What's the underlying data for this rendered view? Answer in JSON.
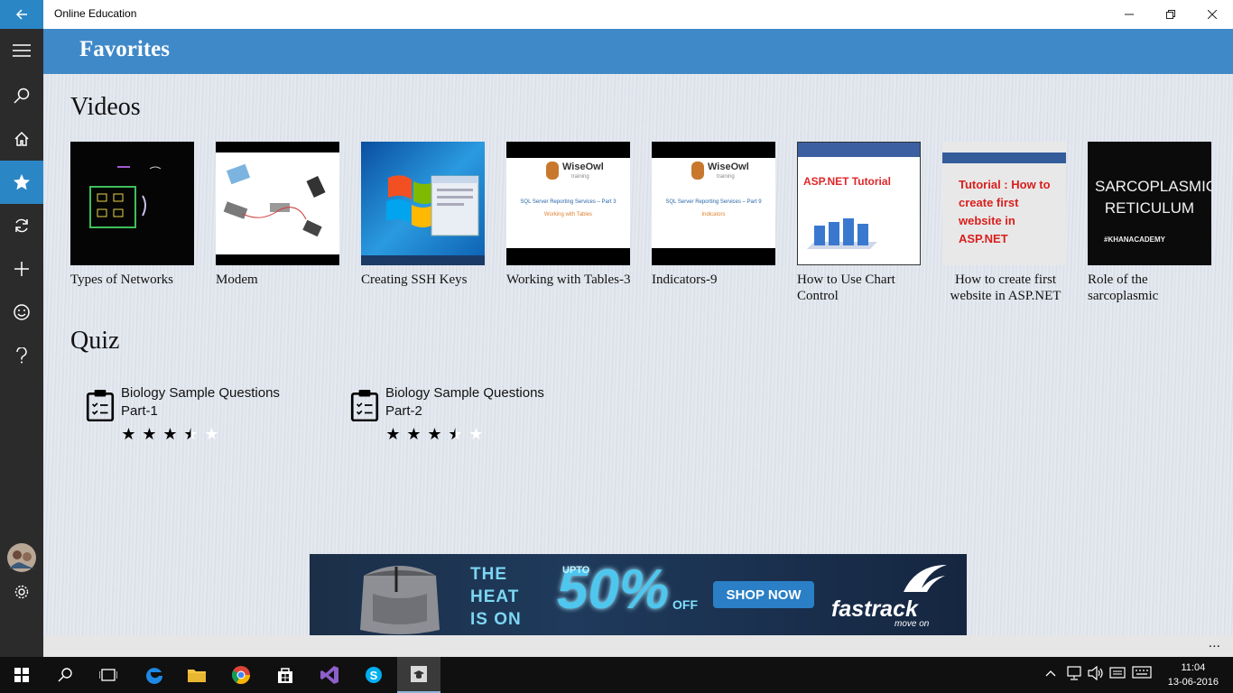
{
  "window": {
    "title": "Online Education"
  },
  "header": {
    "title": "Favorites"
  },
  "nav": {
    "items": [
      {
        "name": "hamburger-menu-icon"
      },
      {
        "name": "search-icon"
      },
      {
        "name": "home-icon"
      },
      {
        "name": "star-icon",
        "active": true
      },
      {
        "name": "refresh-icon"
      },
      {
        "name": "add-icon"
      },
      {
        "name": "smiley-icon"
      },
      {
        "name": "help-icon"
      }
    ]
  },
  "sections": {
    "videos_title": "Videos",
    "quiz_title": "Quiz"
  },
  "videos": [
    {
      "title": "Types of Networks",
      "thumb_text": ""
    },
    {
      "title": "Modem",
      "thumb_text": ""
    },
    {
      "title": "Creating SSH Keys",
      "thumb_text": ""
    },
    {
      "title": "Working with Tables-3",
      "thumb_brand": "WiseOwl",
      "thumb_sub": "training",
      "thumb_text": "SQL Server Reporting Services – Part 3",
      "thumb_text2": "Working with Tables"
    },
    {
      "title": "Indicators-9",
      "thumb_brand": "WiseOwl",
      "thumb_sub": "training",
      "thumb_text": "SQL Server Reporting Services – Part 9",
      "thumb_text2": "Indicators"
    },
    {
      "title": "How to Use Chart Control",
      "thumb_text": "ASP.NET Tutorial"
    },
    {
      "title": "How to create first website in ASP.NET",
      "thumb_text": "Tutorial : How to create first website in ASP.NET"
    },
    {
      "title": "Role of the sarcoplasmic",
      "thumb_text": "SARCOPLASMIC RETICULUM",
      "thumb_text2": "#KHANACADEMY"
    }
  ],
  "quizzes": [
    {
      "title": "Biology Sample Questions Part-1",
      "rating": 3.5,
      "max_rating": 5
    },
    {
      "title": "Biology Sample Questions Part-2",
      "rating": 3.5,
      "max_rating": 5
    }
  ],
  "ad": {
    "headline_1": "THE",
    "headline_2": "HEAT",
    "headline_3": "IS ON",
    "upto": "UPTO",
    "percent": "50%",
    "off": "OFF",
    "cta": "SHOP NOW",
    "brand": "fastrack",
    "tagline": "move on"
  },
  "appbar": {
    "more": "..."
  },
  "taskbar": {
    "time": "11:04",
    "date": "13-06-2016"
  },
  "colors": {
    "accent": "#3f89c8",
    "nav_bg": "#2b2b2b",
    "nav_active": "#2b86c5"
  }
}
